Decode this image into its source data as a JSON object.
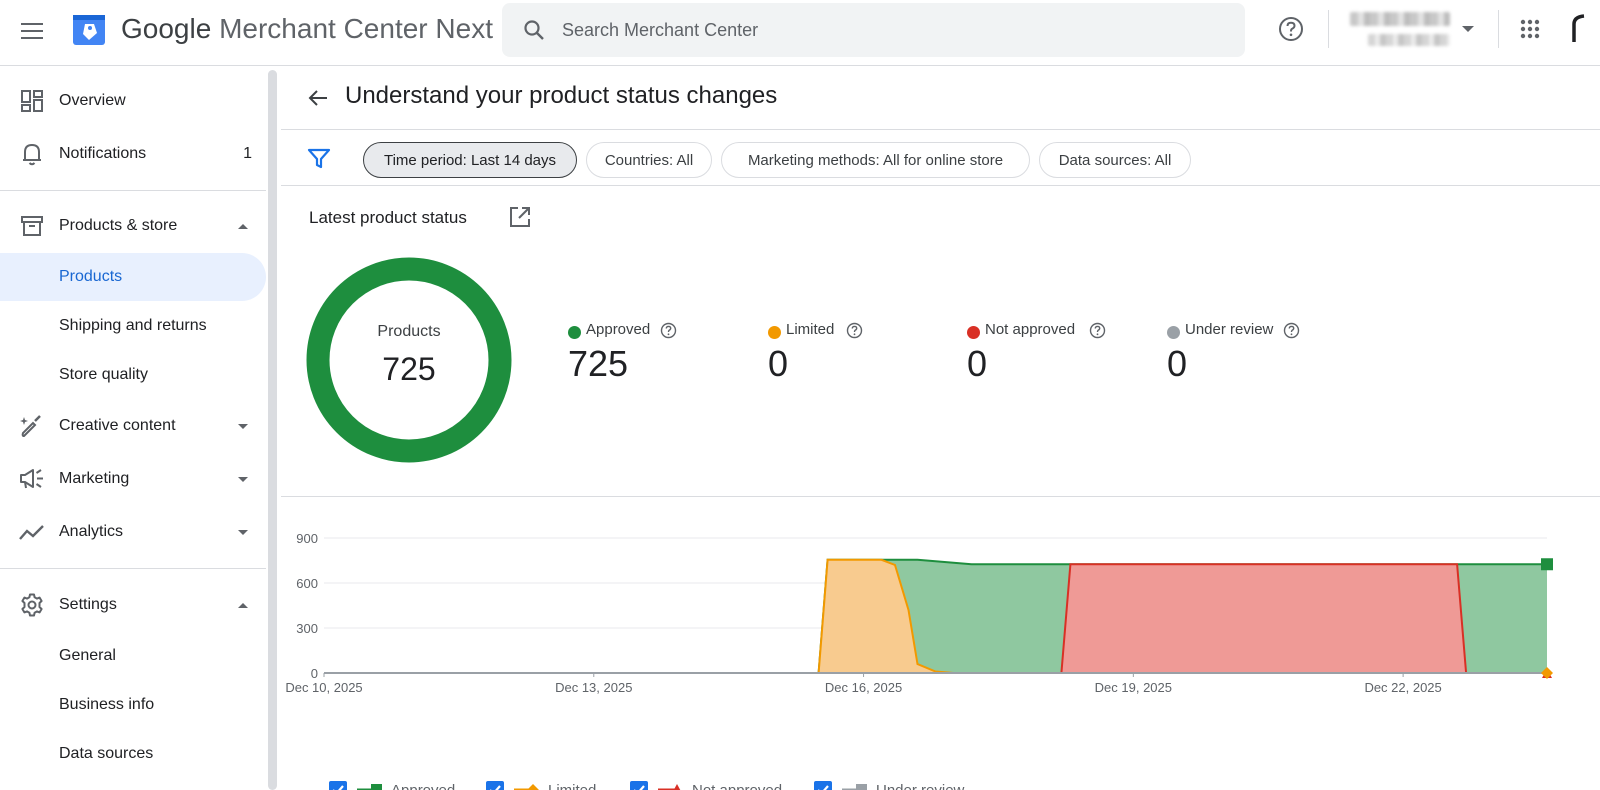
{
  "header": {
    "brand_google": "Google",
    "brand_product": "Merchant Center Next",
    "search_placeholder": "Search Merchant Center"
  },
  "sidebar": {
    "items": [
      {
        "label": "Overview"
      },
      {
        "label": "Notifications",
        "badge": "1"
      },
      {
        "label": "Products & store"
      },
      {
        "label": "Products"
      },
      {
        "label": "Shipping and returns"
      },
      {
        "label": "Store quality"
      },
      {
        "label": "Creative content"
      },
      {
        "label": "Marketing"
      },
      {
        "label": "Analytics"
      },
      {
        "label": "Settings"
      },
      {
        "label": "General"
      },
      {
        "label": "Business info"
      },
      {
        "label": "Data sources"
      }
    ]
  },
  "page": {
    "title": "Understand your product status changes",
    "filters": [
      "Time period: Last 14 days",
      "Countries: All",
      "Marketing methods: All for online store",
      "Data sources: All"
    ],
    "section_title": "Latest product status",
    "donut": {
      "label": "Products",
      "value": "725",
      "color": "#1e8e3e"
    },
    "stats": [
      {
        "name": "Approved",
        "value": "725",
        "color": "#1e8e3e"
      },
      {
        "name": "Limited",
        "value": "0",
        "color": "#f29900"
      },
      {
        "name": "Not approved",
        "value": "0",
        "color": "#d93025"
      },
      {
        "name": "Under review",
        "value": "0",
        "color": "#9aa0a6"
      }
    ]
  },
  "chart_data": {
    "type": "area",
    "y_ticks": [
      "900",
      "600",
      "300",
      "0"
    ],
    "ylim": [
      0,
      900
    ],
    "x_ticks": [
      "Dec 10, 2025",
      "Dec 13, 2025",
      "Dec 16, 2025",
      "Dec 19, 2025",
      "Dec 22, 2025"
    ],
    "x_range_days": [
      0,
      13.6
    ],
    "series": [
      {
        "name": "Approved",
        "color": "#1e8e3e",
        "fill": "#8fc8a0",
        "points": [
          [
            0,
            0
          ],
          [
            5.5,
            0
          ],
          [
            5.6,
            755
          ],
          [
            6.0,
            755
          ],
          [
            6.6,
            755
          ],
          [
            6.9,
            740
          ],
          [
            7.2,
            725
          ],
          [
            9.0,
            725
          ],
          [
            13.6,
            725
          ]
        ]
      },
      {
        "name": "Limited",
        "color": "#f29900",
        "fill": "#f8cb8f",
        "points": [
          [
            0,
            0
          ],
          [
            5.5,
            0
          ],
          [
            5.6,
            755
          ],
          [
            6.2,
            755
          ],
          [
            6.35,
            720
          ],
          [
            6.5,
            420
          ],
          [
            6.6,
            60
          ],
          [
            6.8,
            10
          ],
          [
            7.0,
            0
          ],
          [
            13.6,
            0
          ]
        ]
      },
      {
        "name": "Not approved",
        "color": "#d93025",
        "fill": "#ef9a96",
        "points": [
          [
            0,
            0
          ],
          [
            5.55,
            0
          ],
          [
            5.65,
            20
          ],
          [
            6.6,
            20
          ],
          [
            6.8,
            0
          ],
          [
            8.2,
            0
          ],
          [
            8.3,
            725
          ],
          [
            12.6,
            725
          ],
          [
            12.7,
            0
          ],
          [
            13.6,
            0
          ]
        ]
      },
      {
        "name": "Under review",
        "color": "#9aa0a6",
        "points": [
          [
            0,
            0
          ],
          [
            13.6,
            0
          ]
        ]
      }
    ]
  }
}
